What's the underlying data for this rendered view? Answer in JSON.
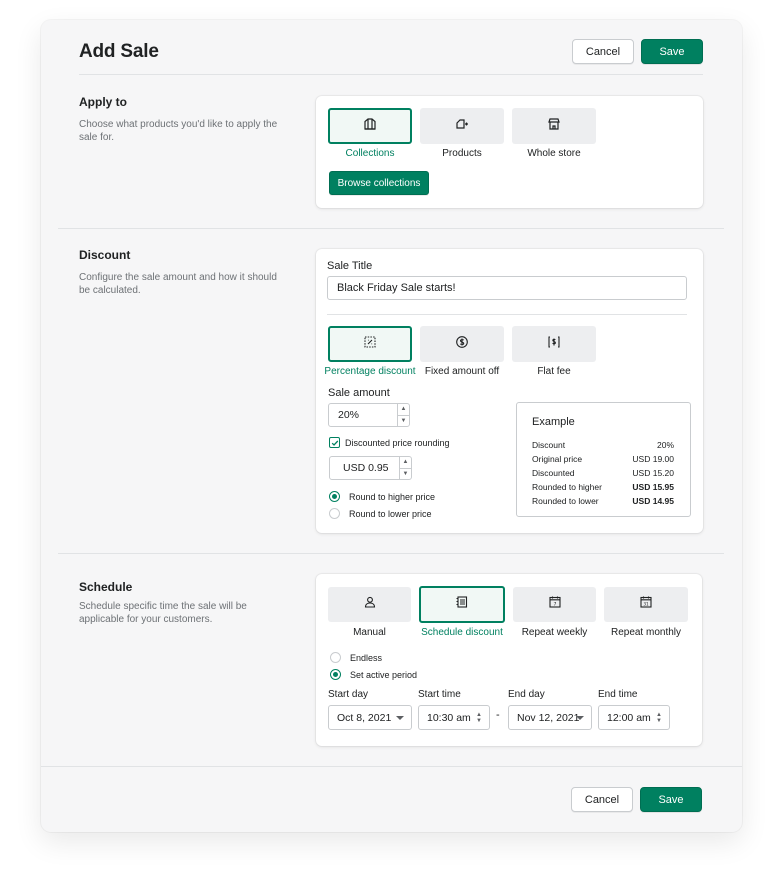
{
  "header": {
    "title": "Add Sale",
    "cancel_label": "Cancel",
    "save_label": "Save"
  },
  "apply_to": {
    "title": "Apply to",
    "description": "Choose what products you'd like to apply the sale for.",
    "options": [
      {
        "label": "Collections",
        "icon": "collection-icon",
        "selected": true
      },
      {
        "label": "Products",
        "icon": "product-tag-icon",
        "selected": false
      },
      {
        "label": "Whole store",
        "icon": "store-icon",
        "selected": false
      }
    ],
    "browse_label": "Browse collections"
  },
  "discount": {
    "title": "Discount",
    "description": "Configure the sale amount and how it should be calculated.",
    "sale_title_label": "Sale Title",
    "sale_title_value": "Black Friday Sale starts!",
    "types": [
      {
        "label": "Percentage discount",
        "icon": "percentage-icon",
        "selected": true
      },
      {
        "label": "Fixed amount off",
        "icon": "dollar-circle-icon",
        "selected": false
      },
      {
        "label": "Flat fee",
        "icon": "price-tag-icon",
        "selected": false
      }
    ],
    "sale_amount_label": "Sale amount",
    "sale_amount_value": "20%",
    "rounding_label": "Discounted price rounding",
    "rounding_checked": true,
    "rounding_value": "USD 0.95",
    "round_higher_label": "Round to higher price",
    "round_lower_label": "Round to lower price",
    "round_selected": "higher",
    "example": {
      "title": "Example",
      "rows": [
        {
          "label": "Discount",
          "value": "20%",
          "bold": false
        },
        {
          "label": "Original price",
          "value": "USD 19.00",
          "bold": false
        },
        {
          "label": "Discounted",
          "value": "USD 15.20",
          "bold": false
        },
        {
          "label": "Rounded to higher",
          "value": "USD 15.95",
          "bold": true
        },
        {
          "label": "Rounded to lower",
          "value": "USD 14.95",
          "bold": true
        }
      ]
    }
  },
  "schedule": {
    "title": "Schedule",
    "description": "Schedule specific time the sale will be applicable for your customers.",
    "options": [
      {
        "label": "Manual",
        "icon": "person-icon",
        "selected": false
      },
      {
        "label": "Schedule discount",
        "icon": "schedule-list-icon",
        "selected": true
      },
      {
        "label": "Repeat weekly",
        "icon": "calendar-7-icon",
        "selected": false
      },
      {
        "label": "Repeat monthly",
        "icon": "calendar-31-icon",
        "selected": false
      }
    ],
    "endless_label": "Endless",
    "active_period_label": "Set active period",
    "period_selected": "active",
    "start_day_label": "Start day",
    "start_day_value": "Oct 8, 2021",
    "start_time_label": "Start time",
    "start_time_value": "10:30 am",
    "separator": "-",
    "end_day_label": "End day",
    "end_day_value": "Nov 12, 2021",
    "end_time_label": "End time",
    "end_time_value": "12:00 am"
  },
  "footer": {
    "cancel_label": "Cancel",
    "save_label": "Save"
  },
  "colors": {
    "accent": "#008060",
    "background": "#f6f6f7",
    "panel": "#ffffff",
    "tile": "#edeef0"
  }
}
